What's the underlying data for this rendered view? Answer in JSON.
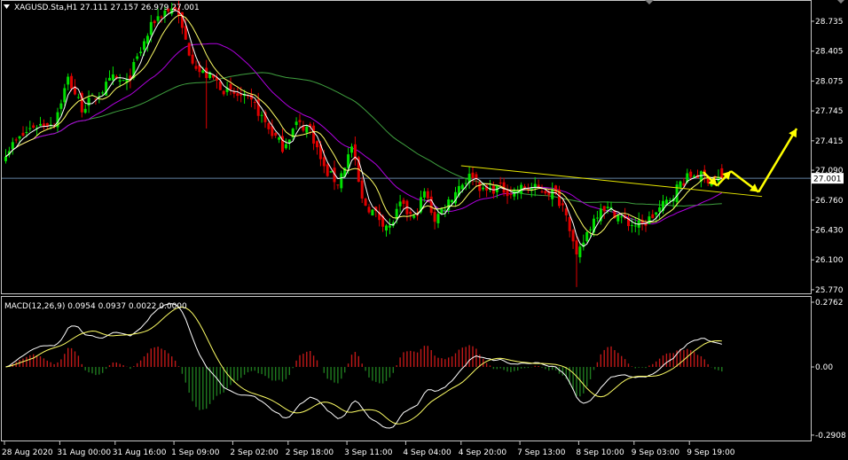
{
  "header": {
    "symbol_line": "XAGUSD.Sta,H1  27.111 27.157 26.979 27.001",
    "menu_icon": "triangle-down-icon"
  },
  "macd_header": "MACD(12,26,9) 0.0954 0.0937 0.0022 0.0000",
  "colors": {
    "background": "#000000",
    "frame": "#c8c8c8",
    "bull": "#00e000",
    "bear": "#e00000",
    "ma_fast": "#ffffff",
    "ma_yellow": "#ffff66",
    "ma_purple": "#b000e0",
    "ma_green": "#3fa03f",
    "trendline": "#e8e800",
    "arrows": "#ffff00",
    "hist_pos": "#c01818",
    "hist_neg": "#1f7a1f",
    "macd_line": "#ffffff",
    "signal_line": "#ffff66",
    "price_line": "#5f7f9f"
  },
  "chart_data": [
    {
      "type": "candlestick",
      "title": "XAGUSD.Sta,H1",
      "ohlc_last": {
        "open": 27.111,
        "high": 27.157,
        "low": 26.979,
        "close": 27.001
      },
      "current_price": "27.001",
      "y_ticks": [
        "28.735",
        "28.405",
        "28.075",
        "27.745",
        "27.415",
        "27.090",
        "26.760",
        "26.430",
        "26.100",
        "25.770"
      ],
      "y_tick_values": [
        28.735,
        28.405,
        28.075,
        27.745,
        27.415,
        27.09,
        26.76,
        26.43,
        26.1,
        25.77
      ],
      "ylim": [
        25.74,
        28.95
      ],
      "x_ticks": [
        "28 Aug 2020",
        "31 Aug 00:00",
        "31 Aug 16:00",
        "1 Sep 09:00",
        "2 Sep 02:00",
        "2 Sep 18:00",
        "3 Sep 11:00",
        "4 Sep 04:00",
        "4 Sep 20:00",
        "7 Sep 13:00",
        "8 Sep 10:00",
        "9 Sep 03:00",
        "9 Sep 19:00"
      ],
      "x_tick_bars": [
        0,
        16,
        32,
        49,
        66,
        82,
        99,
        116,
        132,
        149,
        166,
        182,
        198
      ],
      "bar_count": 208,
      "path_anchors": [
        [
          0,
          27.3
        ],
        [
          8,
          27.58
        ],
        [
          14,
          27.62
        ],
        [
          18,
          28.1
        ],
        [
          22,
          27.78
        ],
        [
          26,
          27.9
        ],
        [
          31,
          28.1
        ],
        [
          35,
          28.05
        ],
        [
          40,
          28.5
        ],
        [
          43,
          28.75
        ],
        [
          46,
          28.85
        ],
        [
          49,
          28.88
        ],
        [
          53,
          28.4
        ],
        [
          56,
          28.18
        ],
        [
          60,
          28.1
        ],
        [
          64,
          27.95
        ],
        [
          68,
          27.9
        ],
        [
          72,
          27.8
        ],
        [
          76,
          27.55
        ],
        [
          80,
          27.35
        ],
        [
          84,
          27.6
        ],
        [
          88,
          27.55
        ],
        [
          92,
          27.1
        ],
        [
          96,
          26.95
        ],
        [
          100,
          27.35
        ],
        [
          103,
          26.75
        ],
        [
          107,
          26.6
        ],
        [
          111,
          26.45
        ],
        [
          114,
          26.7
        ],
        [
          118,
          26.55
        ],
        [
          121,
          26.85
        ],
        [
          124,
          26.55
        ],
        [
          128,
          26.75
        ],
        [
          131,
          26.92
        ],
        [
          135,
          27.05
        ],
        [
          138,
          26.85
        ],
        [
          142,
          26.9
        ],
        [
          146,
          26.85
        ],
        [
          150,
          26.9
        ],
        [
          154,
          26.88
        ],
        [
          158,
          26.85
        ],
        [
          162,
          26.65
        ],
        [
          165,
          26.1
        ],
        [
          168,
          26.4
        ],
        [
          172,
          26.7
        ],
        [
          176,
          26.62
        ],
        [
          180,
          26.5
        ],
        [
          184,
          26.48
        ],
        [
          188,
          26.62
        ],
        [
          192,
          26.78
        ],
        [
          195,
          26.95
        ],
        [
          199,
          27.05
        ],
        [
          203,
          27.0
        ],
        [
          207,
          27.001
        ]
      ],
      "trendline": {
        "from": [
          132,
          27.14
        ],
        "to": [
          219,
          26.8
        ]
      },
      "arrows": [
        [
          [
            202,
            27.07
          ],
          [
            206,
            26.92
          ]
        ],
        [
          [
            206,
            26.92
          ],
          [
            210,
            27.08
          ]
        ],
        [
          [
            210,
            27.08
          ],
          [
            218,
            26.85
          ]
        ],
        [
          [
            218,
            26.85
          ],
          [
            229,
            27.55
          ]
        ]
      ]
    },
    {
      "type": "macd",
      "title": "MACD(12,26,9)",
      "values": {
        "macd": 0.0954,
        "signal": 0.0937,
        "hist": 0.0022,
        "extra": 0.0
      },
      "y_ticks": [
        "0.2762",
        "0.00",
        "-0.2908"
      ],
      "y_tick_values": [
        0.2762,
        0.0,
        -0.2908
      ],
      "ylim": [
        -0.31,
        0.295
      ]
    }
  ]
}
